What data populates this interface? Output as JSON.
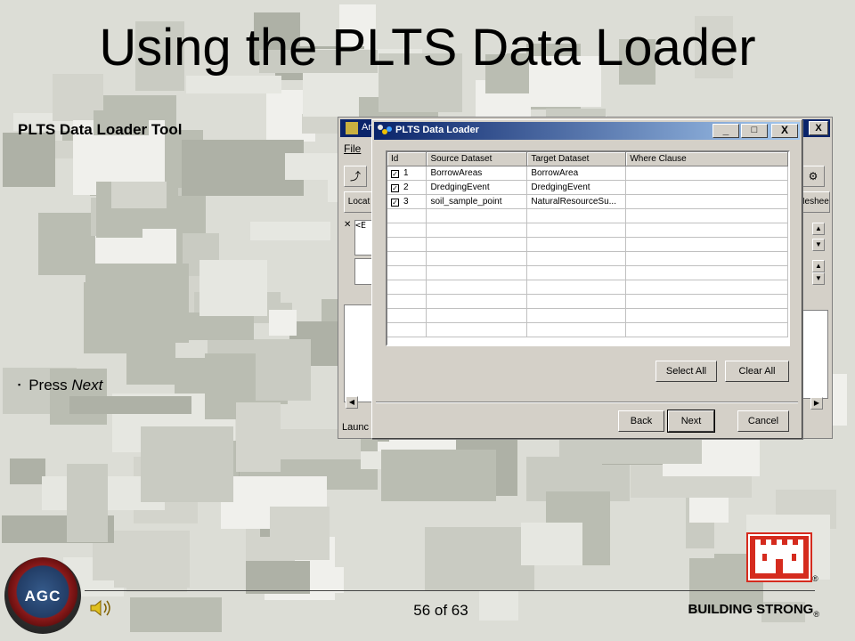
{
  "slide": {
    "title": "Using the PLTS Data Loader",
    "heading": "PLTS Data Loader Tool",
    "bullet_marker": "▪",
    "bullet_prefix": "Press ",
    "bullet_emphasis": "Next"
  },
  "background_window": {
    "title_fragment": "Ar",
    "menu_file": "File",
    "tab_fragment_left": "Locat",
    "tab_fragment_right": "Meshee",
    "field_fragment": "<E",
    "status_fragment": "Launc",
    "close_glyph": "X"
  },
  "dialog": {
    "title": "PLTS Data Loader",
    "controls": {
      "minimize": "_",
      "maximize": "□",
      "close": "X"
    },
    "columns": [
      "Id",
      "Source Dataset",
      "Target Dataset",
      "Where Clause"
    ],
    "rows": [
      {
        "checked": true,
        "id": "1",
        "source": "BorrowAreas",
        "target": "BorrowArea",
        "where": ""
      },
      {
        "checked": true,
        "id": "2",
        "source": "DredgingEvent",
        "target": "DredgingEvent",
        "where": ""
      },
      {
        "checked": true,
        "id": "3",
        "source": "soil_sample_point",
        "target": "NaturalResourceSu...",
        "where": ""
      }
    ],
    "buttons": {
      "select_all": "Select All",
      "clear_all": "Clear All",
      "back": "Back",
      "next": "Next",
      "cancel": "Cancel"
    }
  },
  "footer": {
    "seal_text": "AGC",
    "page_indicator": "56 of 63",
    "brand": "BUILDING STRONG",
    "registered": "®",
    "icons": [
      "agc-seal-icon",
      "speaker-icon",
      "castle-logo-icon"
    ],
    "brand_color": "#d52b1e"
  }
}
